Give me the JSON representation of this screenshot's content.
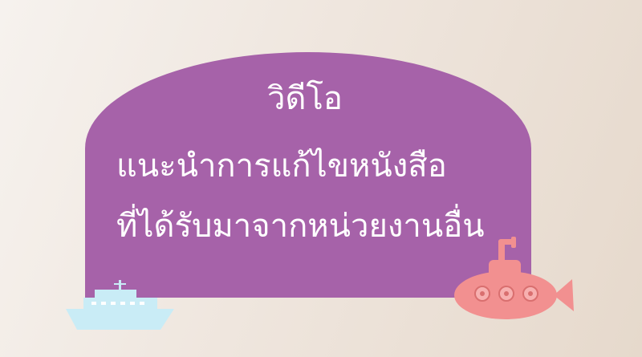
{
  "banner": {
    "line1": "วิดีโอ",
    "line2": "แนะนำการแก้ไขหนังสือ",
    "line3": "ที่ได้รับมาจากหน่วยงานอื่น"
  },
  "colors": {
    "panel": "#a662a9",
    "text": "#ffffff",
    "submarine": "#f29090",
    "ship": "#c9ecf6"
  },
  "icons": [
    "ship-icon",
    "submarine-icon"
  ]
}
